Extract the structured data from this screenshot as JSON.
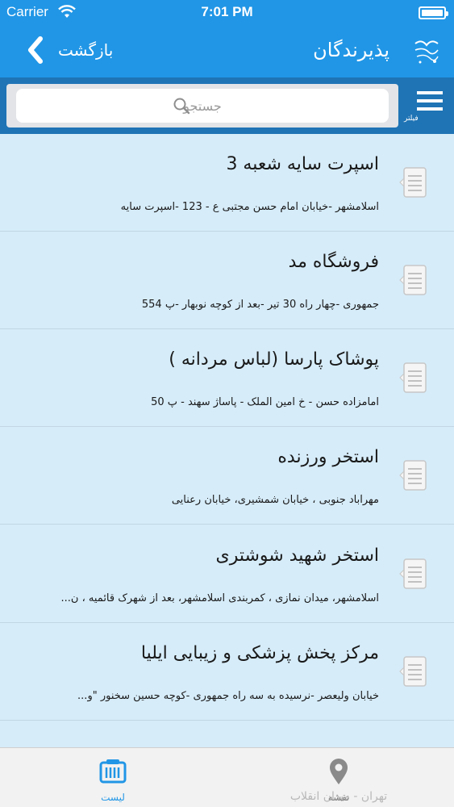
{
  "status_bar": {
    "carrier": "Carrier",
    "time": "7:01 PM",
    "battery_level": 1.0
  },
  "nav": {
    "back_label": "بازگشت",
    "title": "پذیرندگان",
    "back_icon": "chevron-left-icon",
    "logo_icon": "app-logo-icon"
  },
  "search": {
    "placeholder": "جستجو",
    "value": "",
    "filter_label": "فیلتر",
    "filter_icon": "hamburger-menu-icon"
  },
  "list": [
    {
      "title": "اسپرت سایه شعبه 3",
      "address": "اسلامشهر -خیابان امام حسن مجتبی  ع - 123 -اسپرت سایه"
    },
    {
      "title": "فروشگاه مد",
      "address": "جمهوری -چهار راه 30 تیر -بعد از کوچه نوبهار -پ 554"
    },
    {
      "title": "پوشاک پارسا (لباس مردانه )",
      "address": "امامزاده حسن -  خ امین الملک -  پاساژ سهند - پ 50"
    },
    {
      "title": "استخر ورزنده",
      "address": "مهرآباد جنوبی ، خیابان شمشیری، خیابان رعنایی"
    },
    {
      "title": "استخر شهید شوشتری",
      "address": "اسلامشهر، میدان نمازی ، کمربندی اسلامشهر، بعد از شهرک قائمیه ، ن..."
    },
    {
      "title": "مرکز پخش پزشکی و زیبایی ایلیا",
      "address": "خیابان ولیعصر -نرسیده به سه راه جمهوری -کوچه حسین سخنور \"و..."
    }
  ],
  "tabs": {
    "list_label": "لیست",
    "map_label": "نقشه",
    "map_sub": "تهران - میدان انقلاب"
  },
  "colors": {
    "accent": "#2196e6",
    "search_bg": "#1f74b5",
    "list_bg": "#d6ecf9"
  }
}
